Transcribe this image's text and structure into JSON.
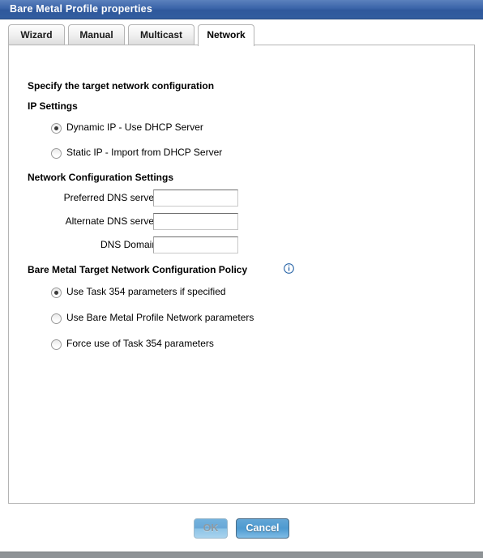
{
  "window": {
    "title": "Bare Metal Profile properties"
  },
  "tabs": [
    {
      "label": "Wizard",
      "active": false
    },
    {
      "label": "Manual",
      "active": false
    },
    {
      "label": "Multicast",
      "active": false
    },
    {
      "label": "Network",
      "active": true
    }
  ],
  "content": {
    "instruction": "Specify the target network configuration",
    "ip_settings": {
      "heading": "IP Settings",
      "options": [
        {
          "label": "Dynamic IP - Use DHCP Server",
          "selected": true
        },
        {
          "label": "Static IP - Import from DHCP Server",
          "selected": false
        }
      ]
    },
    "network_configuration_settings": {
      "heading": "Network Configuration Settings",
      "fields": [
        {
          "label": "Preferred DNS server",
          "value": "",
          "placeholder": ""
        },
        {
          "label": "Alternate DNS server",
          "value": "",
          "placeholder": ""
        },
        {
          "label": "DNS Domain",
          "value": "",
          "placeholder": ""
        }
      ]
    },
    "policy": {
      "heading": "Bare Metal Target Network Configuration Policy",
      "info_icon": "info-icon",
      "options": [
        {
          "label": "Use Task 354 parameters if specified",
          "selected": true
        },
        {
          "label": "Use Bare Metal Profile Network parameters",
          "selected": false
        },
        {
          "label": "Force use of Task 354 parameters",
          "selected": false
        }
      ]
    }
  },
  "buttons": {
    "ok": {
      "label": "OK",
      "enabled": false
    },
    "cancel": {
      "label": "Cancel",
      "enabled": true
    }
  },
  "colors": {
    "titlebar_blue": "#3a64a8",
    "accent_blue": "#4e9ad0",
    "panel_border": "#b4b4b4",
    "info_icon_blue": "#2b66a8"
  }
}
